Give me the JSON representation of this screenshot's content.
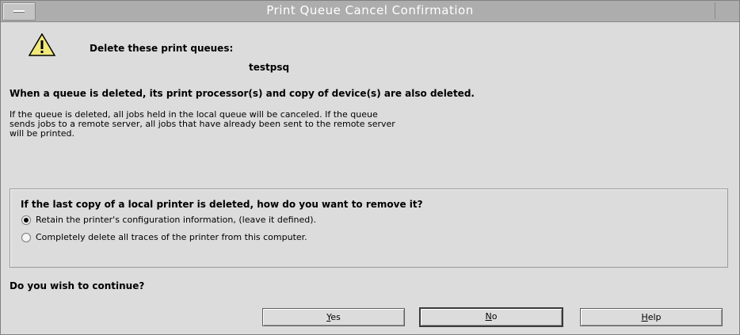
{
  "window": {
    "title": "Print Queue Cancel Confirmation"
  },
  "icons": {
    "warning": "warning-triangle-icon",
    "menu": "window-menu-icon"
  },
  "header": {
    "delete_label": "Delete these print queues:",
    "queue_name": "testpsq"
  },
  "notice": {
    "bold_line": "When a queue is deleted, its print processor(s) and copy of device(s) are also deleted.",
    "line1": "If the queue is deleted, all jobs held in the local queue will be canceled. If the queue",
    "line2": "sends jobs to a remote server, all jobs that have already been sent to the remote server",
    "line3": "will be printed."
  },
  "removal_group": {
    "question": "If the last copy of a local printer is deleted, how do you want to remove it?",
    "options": [
      {
        "label": "Retain the printer's configuration information, (leave it defined).",
        "selected": true
      },
      {
        "label": "Completely delete all traces of the printer from this computer.",
        "selected": false
      }
    ]
  },
  "prompt": "Do you wish to continue?",
  "buttons": {
    "yes_mnemonic": "Y",
    "yes_rest": "es",
    "no_mnemonic": "N",
    "no_rest": "o",
    "help_mnemonic": "H",
    "help_rest": "elp"
  }
}
